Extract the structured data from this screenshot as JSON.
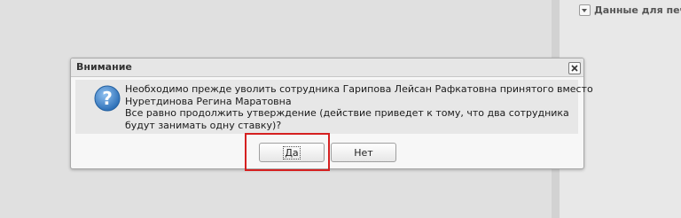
{
  "right_panel": {
    "title": "Данные для печа",
    "collapse_icon": "chevron-down-icon"
  },
  "dialog": {
    "title": "Внимание",
    "close_icon": "close-icon",
    "icon": "question-icon",
    "icon_glyph": "?",
    "message_lines": [
      "Необходимо прежде уволить сотрудника Гарипова Лейсан Рафкатовна принятого вместо",
      "Нуретдинова Регина Маратовна",
      "Все равно продолжить утверждение (действие приведет к тому, что два сотрудника",
      "будут занимать одну ставку)?"
    ],
    "yes_label": "Да",
    "no_label": "Нет"
  },
  "colors": {
    "highlight": "#d52020",
    "icon_blue": "#2c6fb7"
  }
}
